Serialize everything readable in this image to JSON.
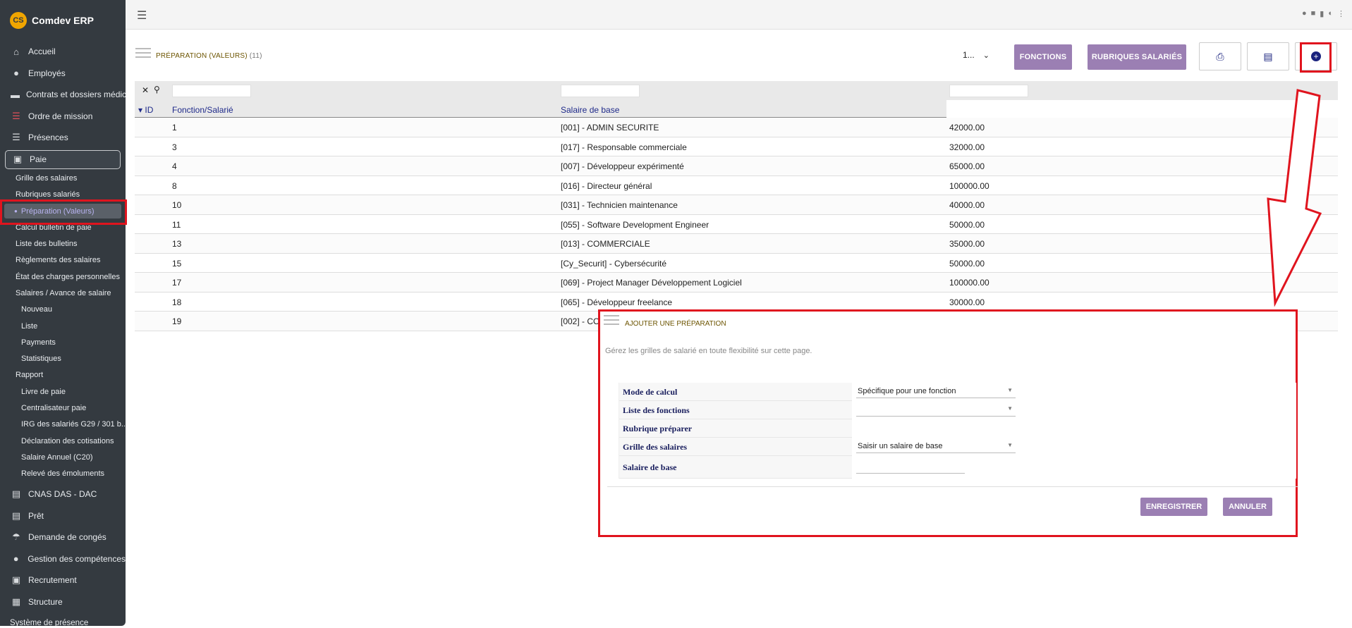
{
  "app": {
    "name": "Comdev ERP",
    "logo_text": "CS"
  },
  "sidebar": {
    "top_items": [
      {
        "label": "Accueil",
        "icon": "home-icon"
      },
      {
        "label": "Employés",
        "icon": "user-icon"
      },
      {
        "label": "Contrats et dossiers médic",
        "icon": "folder-icon"
      },
      {
        "label": "Ordre de mission",
        "icon": "list-red-icon"
      },
      {
        "label": "Présences",
        "icon": "list-icon"
      }
    ],
    "active_item": {
      "label": "Paie",
      "icon": "money-icon"
    },
    "paie_sub": [
      "Grille des salaires",
      "Rubriques salariés",
      "Préparation (Valeurs)",
      "Calcul bulletin de paie",
      "Liste des bulletins",
      "Règlements des salaires",
      "État des charges personnelles",
      "Salaires / Avance de salaire"
    ],
    "avance_sub": [
      "Nouveau",
      "Liste",
      "Payments",
      "Statistiques"
    ],
    "rapport_label": "Rapport",
    "rapport_sub": [
      "Livre de paie",
      "Centralisateur paie",
      "IRG des salariés G29 / 301 b...",
      "Déclaration des cotisations",
      "Salaire Annuel (C20)",
      "Relevé des émoluments"
    ],
    "bottom_items": [
      {
        "label": "CNAS DAS - DAC",
        "icon": "file-icon"
      },
      {
        "label": "Prêt",
        "icon": "document-icon"
      },
      {
        "label": "Demande de congés",
        "icon": "umbrella-icon"
      },
      {
        "label": "Gestion des compétences",
        "icon": "users-icon"
      },
      {
        "label": "Recrutement",
        "icon": "badge-icon"
      },
      {
        "label": "Structure",
        "icon": "building-icon"
      }
    ],
    "footer_label": "Système de présence"
  },
  "header": {
    "title": "PRÉPARATION (VALEURS)",
    "count": "(11)",
    "page_select": "1...",
    "btn_fonctions": "FONCTIONS",
    "btn_rubriques": "RUBRIQUES SALARIÉS"
  },
  "table": {
    "columns": [
      "ID",
      "Fonction/Salarié",
      "Salaire de base"
    ],
    "rows": [
      [
        "1",
        "[001] - ADMIN SECURITE",
        "42000.00"
      ],
      [
        "3",
        "[017] - Responsable commerciale",
        "32000.00"
      ],
      [
        "4",
        "[007] - Développeur expérimenté",
        "65000.00"
      ],
      [
        "8",
        "[016] - Directeur général",
        "100000.00"
      ],
      [
        "10",
        "[031] - Technicien maintenance",
        "40000.00"
      ],
      [
        "11",
        "[055] - Software Development Engineer",
        "50000.00"
      ],
      [
        "13",
        "[013] - COMMERCIALE",
        "35000.00"
      ],
      [
        "15",
        "[Cy_Securit] - Cybersécurité",
        "50000.00"
      ],
      [
        "17",
        "[069] - Project Manager Développement Logiciel",
        "100000.00"
      ],
      [
        "18",
        "[065] - Développeur freelance",
        "30000.00"
      ],
      [
        "19",
        "[002] - CO",
        ""
      ]
    ]
  },
  "modal": {
    "title": "AJOUTER UNE PRÉPARATION",
    "subtitle": "Gérez les grilles de salarié en toute flexibilité sur cette page.",
    "fields": {
      "mode_label": "Mode de calcul",
      "mode_value": "Spécifique pour une fonction",
      "fonctions_label": "Liste des fonctions",
      "fonctions_value": "",
      "rubrique_label": "Rubrique préparer",
      "grille_label": "Grille des salaires",
      "grille_value": "Saisir un salaire de base",
      "salaire_label": "Salaire de base"
    },
    "btn_save": "ENREGISTRER",
    "btn_cancel": "ANNULER"
  },
  "colors": {
    "accent": "#9b7fb3",
    "annotation": "#e0141e",
    "sidebar": "#343a40",
    "header_text": "#1f2a8a"
  }
}
